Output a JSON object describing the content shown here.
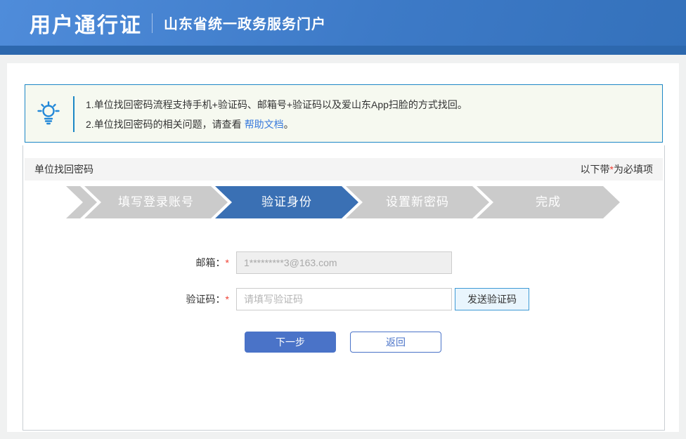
{
  "header": {
    "title": "用户通行证",
    "subtitle": "山东省统一政务服务门户"
  },
  "notice": {
    "line1": "1.单位找回密码流程支持手机+验证码、邮箱号+验证码以及爱山东App扫脸的方式找回。",
    "line2_prefix": "2.单位找回密码的相关问题，请查看",
    "line2_link": "帮助文档",
    "line2_suffix": "。"
  },
  "section": {
    "title": "单位找回密码",
    "required_note_prefix": "以下带",
    "required_star": "*",
    "required_note_suffix": "为必填项"
  },
  "steps": [
    {
      "label": "填写登录账号",
      "active": false
    },
    {
      "label": "验证身份",
      "active": true
    },
    {
      "label": "设置新密码",
      "active": false
    },
    {
      "label": "完成",
      "active": false
    }
  ],
  "form": {
    "email": {
      "label": "邮箱：",
      "required_mark": "*",
      "value": "1*********3@163.com"
    },
    "captcha": {
      "label": "验证码：",
      "required_mark": "*",
      "placeholder": "请填写验证码",
      "send_button_label": "发送验证码"
    },
    "next_button_label": "下一步",
    "back_button_label": "返回"
  },
  "icons": {
    "tip": "lightbulb-icon"
  },
  "colors": {
    "header_blue_top": "#4f8cda",
    "header_blue_bottom_strip": "#2d68ae",
    "notice_border_blue": "#1d87c6",
    "notice_background": "#f6f9f0",
    "link_blue": "#3a7bdc",
    "step_active_blue": "#3a70b4",
    "step_inactive_gray": "#cbcbcb",
    "primary_button_blue": "#4a73c8",
    "send_button_border_blue": "#3e9ad5",
    "send_button_background": "#e9f5fd",
    "required_red": "#f04134"
  }
}
